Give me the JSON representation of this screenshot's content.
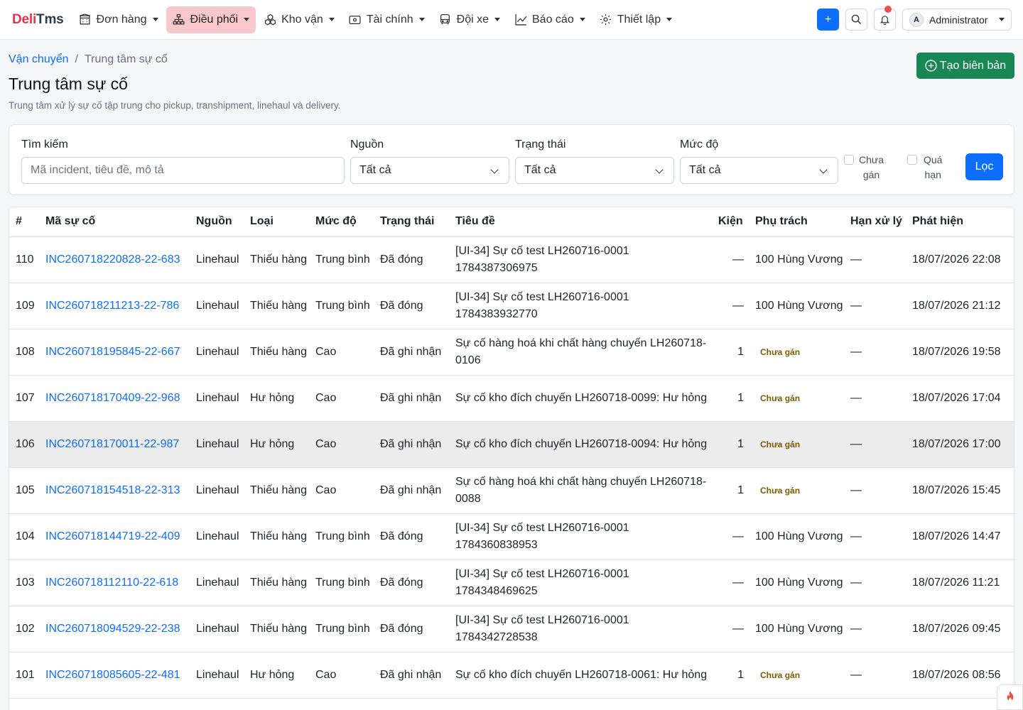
{
  "brand": {
    "part1": "Deli",
    "part2": "Tms"
  },
  "nav": {
    "items": [
      {
        "label": "Đơn hàng",
        "icon": "building-icon"
      },
      {
        "label": "Điều phối",
        "icon": "sitemap-icon"
      },
      {
        "label": "Kho vận",
        "icon": "boxes-icon"
      },
      {
        "label": "Tài chính",
        "icon": "wallet-icon"
      },
      {
        "label": "Đội xe",
        "icon": "bus-icon"
      },
      {
        "label": "Báo cáo",
        "icon": "chart-line-icon"
      },
      {
        "label": "Thiết lập",
        "icon": "gear-icon"
      }
    ],
    "active_index": 1,
    "quick_add_label": "+",
    "user": {
      "initial": "A",
      "name": "Administrator"
    }
  },
  "breadcrumb": {
    "parent": "Vận chuyển",
    "separator": "/",
    "current": "Trung tâm sự cố"
  },
  "page": {
    "title": "Trung tâm sự cố",
    "subtitle": "Trung tâm xử lý sự cố tập trung cho pickup, transhipment, linehaul và delivery.",
    "create_button": "Tạo biên bản"
  },
  "filters": {
    "search_label": "Tìm kiếm",
    "search_placeholder": "Mã incident, tiêu đề, mô tả",
    "source_label": "Nguồn",
    "source_value": "Tất cả",
    "status_label": "Trạng thái",
    "status_value": "Tất cả",
    "severity_label": "Mức độ",
    "severity_value": "Tất cả",
    "unassigned_line1": "Chưa",
    "unassigned_line2": "gán",
    "overdue_line1": "Quá",
    "overdue_line2": "hạn",
    "filter_button": "Lọc"
  },
  "table": {
    "headers": [
      "#",
      "Mã sự cố",
      "Nguồn",
      "Loại",
      "Mức độ",
      "Trạng thái",
      "Tiêu đề",
      "Kiện",
      "Phụ trách",
      "Hạn xử lý",
      "Phát hiện"
    ],
    "rows": [
      {
        "id": "110",
        "code": "INC260718220828-22-683",
        "source": "Linehaul",
        "type": "Thiếu hàng",
        "severity": "Trung bình",
        "status": "Đã đóng",
        "title": "[UI-34] Sự cố test LH260716-0001 1784387306975",
        "parcels": "—",
        "owner": "100 Hùng Vương",
        "due": "—",
        "detected": "18/07/2026 22:08"
      },
      {
        "id": "109",
        "code": "INC260718211213-22-786",
        "source": "Linehaul",
        "type": "Thiếu hàng",
        "severity": "Trung bình",
        "status": "Đã đóng",
        "title": "[UI-34] Sự cố test LH260716-0001 1784383932770",
        "parcels": "—",
        "owner": "100 Hùng Vương",
        "due": "—",
        "detected": "18/07/2026 21:12"
      },
      {
        "id": "108",
        "code": "INC260718195845-22-667",
        "source": "Linehaul",
        "type": "Thiếu hàng",
        "severity": "Cao",
        "status": "Đã ghi nhận",
        "title": "Sự cố hàng hoá khi chất hàng chuyến LH260718-0106",
        "parcels": "1",
        "owner": "Chưa gán",
        "due": "—",
        "detected": "18/07/2026 19:58"
      },
      {
        "id": "107",
        "code": "INC260718170409-22-968",
        "source": "Linehaul",
        "type": "Hư hỏng",
        "severity": "Cao",
        "status": "Đã ghi nhận",
        "title": "Sự cố kho đích chuyến LH260718-0099: Hư hỏng",
        "parcels": "1",
        "owner": "Chưa gán",
        "due": "—",
        "detected": "18/07/2026 17:04"
      },
      {
        "id": "106",
        "code": "INC260718170011-22-987",
        "source": "Linehaul",
        "type": "Hư hỏng",
        "severity": "Cao",
        "status": "Đã ghi nhận",
        "title": "Sự cố kho đích chuyến LH260718-0094: Hư hỏng",
        "parcels": "1",
        "owner": "Chưa gán",
        "due": "—",
        "detected": "18/07/2026 17:00"
      },
      {
        "id": "105",
        "code": "INC260718154518-22-313",
        "source": "Linehaul",
        "type": "Thiếu hàng",
        "severity": "Cao",
        "status": "Đã ghi nhận",
        "title": "Sự cố hàng hoá khi chất hàng chuyến LH260718-0088",
        "parcels": "1",
        "owner": "Chưa gán",
        "due": "—",
        "detected": "18/07/2026 15:45"
      },
      {
        "id": "104",
        "code": "INC260718144719-22-409",
        "source": "Linehaul",
        "type": "Thiếu hàng",
        "severity": "Trung bình",
        "status": "Đã đóng",
        "title": "[UI-34] Sự cố test LH260716-0001 1784360838953",
        "parcels": "—",
        "owner": "100 Hùng Vương",
        "due": "—",
        "detected": "18/07/2026 14:47"
      },
      {
        "id": "103",
        "code": "INC260718112110-22-618",
        "source": "Linehaul",
        "type": "Thiếu hàng",
        "severity": "Trung bình",
        "status": "Đã đóng",
        "title": "[UI-34] Sự cố test LH260716-0001 1784348469625",
        "parcels": "—",
        "owner": "100 Hùng Vương",
        "due": "—",
        "detected": "18/07/2026 11:21"
      },
      {
        "id": "102",
        "code": "INC260718094529-22-238",
        "source": "Linehaul",
        "type": "Thiếu hàng",
        "severity": "Trung bình",
        "status": "Đã đóng",
        "title": "[UI-34] Sự cố test LH260716-0001 1784342728538",
        "parcels": "—",
        "owner": "100 Hùng Vương",
        "due": "—",
        "detected": "18/07/2026 09:45"
      },
      {
        "id": "101",
        "code": "INC260718085605-22-481",
        "source": "Linehaul",
        "type": "Hư hỏng",
        "severity": "Cao",
        "status": "Đã ghi nhận",
        "title": "Sự cố kho đích chuyến LH260718-0061: Hư hỏng",
        "parcels": "1",
        "owner": "Chưa gán",
        "due": "—",
        "detected": "18/07/2026 08:56"
      }
    ],
    "hover_row_index": 4,
    "unassigned_text": "Chưa gán"
  },
  "colors": {
    "primary": "#0d6efd",
    "success": "#198754",
    "brand_red": "#e8344b",
    "active_nav_bg": "#f8c8cd"
  }
}
